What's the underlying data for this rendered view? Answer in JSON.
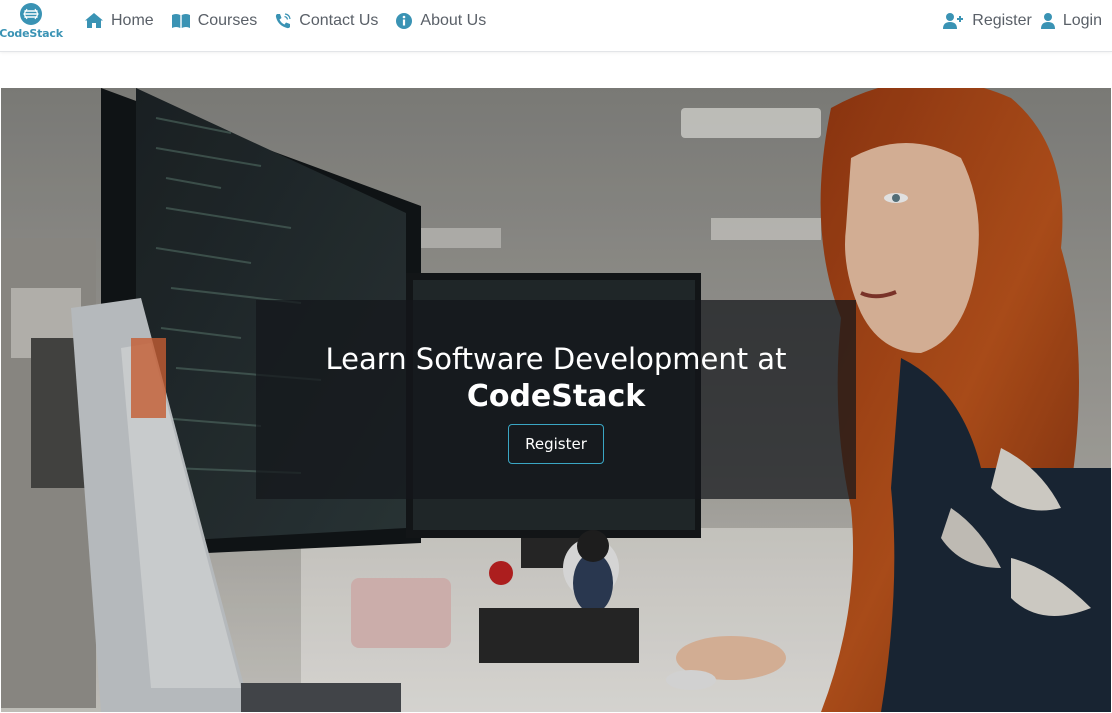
{
  "brand": {
    "name": "CodeStack",
    "logo_icon": "codestack-logo-icon",
    "color": "#3a93b4"
  },
  "nav": {
    "left": [
      {
        "label": "Home",
        "icon": "home-icon"
      },
      {
        "label": "Courses",
        "icon": "book-icon"
      },
      {
        "label": "Contact Us",
        "icon": "phone-icon"
      },
      {
        "label": "About Us",
        "icon": "info-icon"
      }
    ],
    "right": [
      {
        "label": "Register",
        "icon": "user-plus-icon"
      },
      {
        "label": "Login",
        "icon": "user-icon"
      }
    ],
    "icon_color": "#3a93b4",
    "text_color": "#5a6068"
  },
  "hero": {
    "title": "Learn Software Development at",
    "brand": "CodeStack",
    "cta_label": "Register",
    "cta_border_color": "#3aa6c4",
    "image": "woman working at computer with code on monitors"
  }
}
